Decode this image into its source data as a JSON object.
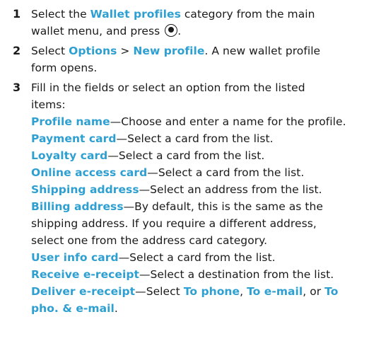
{
  "steps": [
    {
      "number": "1",
      "line1_pre": "Select the ",
      "line1_hl": "Wallet profiles",
      "line1_post": " category from the main",
      "line2_text": "wallet menu, and press",
      "line2_end": ".",
      "key_icon": "select-key-icon"
    },
    {
      "number": "2",
      "line1_pre": "Select ",
      "line1_hl1": "Options",
      "line1_sep": " > ",
      "line1_hl2": "New profile",
      "line1_post": ". A new wallet profile",
      "line2_text": "form opens."
    },
    {
      "number": "3",
      "intro1": "Fill in the fields or select an option from the listed",
      "intro2": "items:",
      "fields": [
        {
          "name": "Profile name",
          "desc": "—Choose and enter a name for the profile."
        },
        {
          "name": "Payment card",
          "desc": "—Select a card from the list."
        },
        {
          "name": "Loyalty card",
          "desc": "—Select a card from the list."
        },
        {
          "name": "Online access card",
          "desc": "—Select a card from the list."
        },
        {
          "name": "Shipping address",
          "desc": "—Select an address from the list."
        },
        {
          "name": "Billing address",
          "desc": "—By default, this is the same as the"
        },
        {
          "name": "User info card",
          "desc": "—Select a card from the list."
        },
        {
          "name": "Receive e-receipt",
          "desc": "—Select a destination from the list."
        },
        {
          "name": "Deliver e-receipt",
          "desc": "—Select "
        }
      ],
      "billing_cont1": "shipping address. If you require a different address,",
      "billing_cont2": "select one from the address card category.",
      "deliver_opt1": "To phone",
      "deliver_sep1": ", ",
      "deliver_opt2": "To e-mail",
      "deliver_sep2": ", or ",
      "deliver_opt3a": "To",
      "deliver_opt3b": "pho. & e-mail",
      "deliver_end": "."
    }
  ],
  "colors": {
    "highlight": "#2e9fd1",
    "text": "#1a1a1a"
  }
}
